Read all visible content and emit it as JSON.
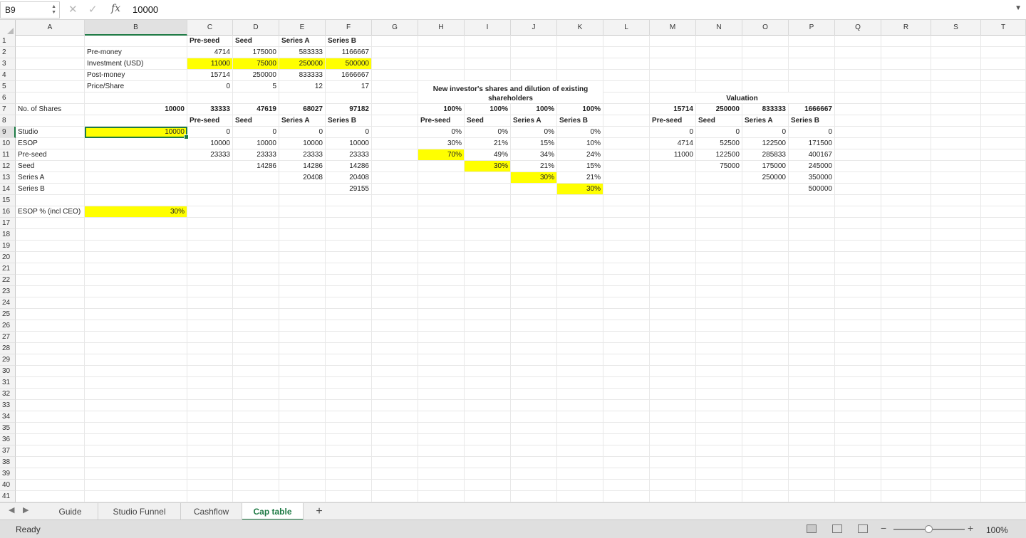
{
  "formula_bar": {
    "name_box": "B9",
    "fx_label": "fx",
    "value": "10000"
  },
  "columns": [
    "A",
    "B",
    "C",
    "D",
    "E",
    "F",
    "G",
    "H",
    "I",
    "J",
    "K",
    "L",
    "M",
    "N",
    "O",
    "P",
    "Q",
    "R",
    "S",
    "T"
  ],
  "selected_column": "B",
  "selected_row": 9,
  "row_count": 41,
  "cells": [
    {
      "r": 1,
      "c": "C",
      "v": "Pre-seed",
      "t": "txt",
      "b": true
    },
    {
      "r": 1,
      "c": "D",
      "v": "Seed",
      "t": "txt",
      "b": true
    },
    {
      "r": 1,
      "c": "E",
      "v": "Series A",
      "t": "txt",
      "b": true
    },
    {
      "r": 1,
      "c": "F",
      "v": "Series B",
      "t": "txt",
      "b": true
    },
    {
      "r": 2,
      "c": "B",
      "v": "Pre-money",
      "t": "txt"
    },
    {
      "r": 2,
      "c": "C",
      "v": "4714",
      "t": "num"
    },
    {
      "r": 2,
      "c": "D",
      "v": "175000",
      "t": "num"
    },
    {
      "r": 2,
      "c": "E",
      "v": "583333",
      "t": "num"
    },
    {
      "r": 2,
      "c": "F",
      "v": "1166667",
      "t": "num"
    },
    {
      "r": 3,
      "c": "B",
      "v": "Investment (USD)",
      "t": "txt"
    },
    {
      "r": 3,
      "c": "C",
      "v": "11000",
      "t": "num",
      "y": true
    },
    {
      "r": 3,
      "c": "D",
      "v": "75000",
      "t": "num",
      "y": true
    },
    {
      "r": 3,
      "c": "E",
      "v": "250000",
      "t": "num",
      "y": true
    },
    {
      "r": 3,
      "c": "F",
      "v": "500000",
      "t": "num",
      "y": true
    },
    {
      "r": 4,
      "c": "B",
      "v": "Post-money",
      "t": "txt"
    },
    {
      "r": 4,
      "c": "C",
      "v": "15714",
      "t": "num"
    },
    {
      "r": 4,
      "c": "D",
      "v": "250000",
      "t": "num"
    },
    {
      "r": 4,
      "c": "E",
      "v": "833333",
      "t": "num"
    },
    {
      "r": 4,
      "c": "F",
      "v": "1666667",
      "t": "num"
    },
    {
      "r": 5,
      "c": "B",
      "v": "Price/Share",
      "t": "txt"
    },
    {
      "r": 5,
      "c": "C",
      "v": "0",
      "t": "num"
    },
    {
      "r": 5,
      "c": "D",
      "v": "5",
      "t": "num"
    },
    {
      "r": 5,
      "c": "E",
      "v": "12",
      "t": "num"
    },
    {
      "r": 5,
      "c": "F",
      "v": "17",
      "t": "num"
    },
    {
      "r": 7,
      "c": "A",
      "v": "No. of Shares",
      "t": "txt"
    },
    {
      "r": 7,
      "c": "B",
      "v": "10000",
      "t": "num",
      "b": true
    },
    {
      "r": 7,
      "c": "C",
      "v": "33333",
      "t": "num",
      "b": true
    },
    {
      "r": 7,
      "c": "D",
      "v": "47619",
      "t": "num",
      "b": true
    },
    {
      "r": 7,
      "c": "E",
      "v": "68027",
      "t": "num",
      "b": true
    },
    {
      "r": 7,
      "c": "F",
      "v": "97182",
      "t": "num",
      "b": true
    },
    {
      "r": 7,
      "c": "H",
      "v": "100%",
      "t": "num",
      "b": true
    },
    {
      "r": 7,
      "c": "I",
      "v": "100%",
      "t": "num",
      "b": true
    },
    {
      "r": 7,
      "c": "J",
      "v": "100%",
      "t": "num",
      "b": true
    },
    {
      "r": 7,
      "c": "K",
      "v": "100%",
      "t": "num",
      "b": true
    },
    {
      "r": 7,
      "c": "M",
      "v": "15714",
      "t": "num",
      "b": true
    },
    {
      "r": 7,
      "c": "N",
      "v": "250000",
      "t": "num",
      "b": true
    },
    {
      "r": 7,
      "c": "O",
      "v": "833333",
      "t": "num",
      "b": true
    },
    {
      "r": 7,
      "c": "P",
      "v": "1666667",
      "t": "num",
      "b": true
    },
    {
      "r": 8,
      "c": "C",
      "v": "Pre-seed",
      "t": "txt",
      "b": true
    },
    {
      "r": 8,
      "c": "D",
      "v": "Seed",
      "t": "txt",
      "b": true
    },
    {
      "r": 8,
      "c": "E",
      "v": "Series A",
      "t": "txt",
      "b": true
    },
    {
      "r": 8,
      "c": "F",
      "v": "Series B",
      "t": "txt",
      "b": true
    },
    {
      "r": 8,
      "c": "H",
      "v": "Pre-seed",
      "t": "txt",
      "b": true
    },
    {
      "r": 8,
      "c": "I",
      "v": "Seed",
      "t": "txt",
      "b": true
    },
    {
      "r": 8,
      "c": "J",
      "v": "Series A",
      "t": "txt",
      "b": true
    },
    {
      "r": 8,
      "c": "K",
      "v": "Series B",
      "t": "txt",
      "b": true
    },
    {
      "r": 8,
      "c": "M",
      "v": "Pre-seed",
      "t": "txt",
      "b": true
    },
    {
      "r": 8,
      "c": "N",
      "v": "Seed",
      "t": "txt",
      "b": true
    },
    {
      "r": 8,
      "c": "O",
      "v": "Series A",
      "t": "txt",
      "b": true
    },
    {
      "r": 8,
      "c": "P",
      "v": "Series B",
      "t": "txt",
      "b": true
    },
    {
      "r": 9,
      "c": "A",
      "v": "Studio",
      "t": "txt"
    },
    {
      "r": 9,
      "c": "B",
      "v": "10000",
      "t": "num",
      "y": true,
      "active": true
    },
    {
      "r": 9,
      "c": "C",
      "v": "0",
      "t": "num"
    },
    {
      "r": 9,
      "c": "D",
      "v": "0",
      "t": "num"
    },
    {
      "r": 9,
      "c": "E",
      "v": "0",
      "t": "num"
    },
    {
      "r": 9,
      "c": "F",
      "v": "0",
      "t": "num"
    },
    {
      "r": 9,
      "c": "H",
      "v": "0%",
      "t": "num"
    },
    {
      "r": 9,
      "c": "I",
      "v": "0%",
      "t": "num"
    },
    {
      "r": 9,
      "c": "J",
      "v": "0%",
      "t": "num"
    },
    {
      "r": 9,
      "c": "K",
      "v": "0%",
      "t": "num"
    },
    {
      "r": 9,
      "c": "M",
      "v": "0",
      "t": "num"
    },
    {
      "r": 9,
      "c": "N",
      "v": "0",
      "t": "num"
    },
    {
      "r": 9,
      "c": "O",
      "v": "0",
      "t": "num"
    },
    {
      "r": 9,
      "c": "P",
      "v": "0",
      "t": "num"
    },
    {
      "r": 10,
      "c": "A",
      "v": "ESOP",
      "t": "txt"
    },
    {
      "r": 10,
      "c": "C",
      "v": "10000",
      "t": "num"
    },
    {
      "r": 10,
      "c": "D",
      "v": "10000",
      "t": "num"
    },
    {
      "r": 10,
      "c": "E",
      "v": "10000",
      "t": "num"
    },
    {
      "r": 10,
      "c": "F",
      "v": "10000",
      "t": "num"
    },
    {
      "r": 10,
      "c": "H",
      "v": "30%",
      "t": "num"
    },
    {
      "r": 10,
      "c": "I",
      "v": "21%",
      "t": "num"
    },
    {
      "r": 10,
      "c": "J",
      "v": "15%",
      "t": "num"
    },
    {
      "r": 10,
      "c": "K",
      "v": "10%",
      "t": "num"
    },
    {
      "r": 10,
      "c": "M",
      "v": "4714",
      "t": "num"
    },
    {
      "r": 10,
      "c": "N",
      "v": "52500",
      "t": "num"
    },
    {
      "r": 10,
      "c": "O",
      "v": "122500",
      "t": "num"
    },
    {
      "r": 10,
      "c": "P",
      "v": "171500",
      "t": "num"
    },
    {
      "r": 11,
      "c": "A",
      "v": "Pre-seed",
      "t": "txt"
    },
    {
      "r": 11,
      "c": "C",
      "v": "23333",
      "t": "num"
    },
    {
      "r": 11,
      "c": "D",
      "v": "23333",
      "t": "num"
    },
    {
      "r": 11,
      "c": "E",
      "v": "23333",
      "t": "num"
    },
    {
      "r": 11,
      "c": "F",
      "v": "23333",
      "t": "num"
    },
    {
      "r": 11,
      "c": "H",
      "v": "70%",
      "t": "num",
      "y": true
    },
    {
      "r": 11,
      "c": "I",
      "v": "49%",
      "t": "num"
    },
    {
      "r": 11,
      "c": "J",
      "v": "34%",
      "t": "num"
    },
    {
      "r": 11,
      "c": "K",
      "v": "24%",
      "t": "num"
    },
    {
      "r": 11,
      "c": "M",
      "v": "11000",
      "t": "num"
    },
    {
      "r": 11,
      "c": "N",
      "v": "122500",
      "t": "num"
    },
    {
      "r": 11,
      "c": "O",
      "v": "285833",
      "t": "num"
    },
    {
      "r": 11,
      "c": "P",
      "v": "400167",
      "t": "num"
    },
    {
      "r": 12,
      "c": "A",
      "v": "Seed",
      "t": "txt"
    },
    {
      "r": 12,
      "c": "D",
      "v": "14286",
      "t": "num"
    },
    {
      "r": 12,
      "c": "E",
      "v": "14286",
      "t": "num"
    },
    {
      "r": 12,
      "c": "F",
      "v": "14286",
      "t": "num"
    },
    {
      "r": 12,
      "c": "I",
      "v": "30%",
      "t": "num",
      "y": true
    },
    {
      "r": 12,
      "c": "J",
      "v": "21%",
      "t": "num"
    },
    {
      "r": 12,
      "c": "K",
      "v": "15%",
      "t": "num"
    },
    {
      "r": 12,
      "c": "N",
      "v": "75000",
      "t": "num"
    },
    {
      "r": 12,
      "c": "O",
      "v": "175000",
      "t": "num"
    },
    {
      "r": 12,
      "c": "P",
      "v": "245000",
      "t": "num"
    },
    {
      "r": 13,
      "c": "A",
      "v": "Series A",
      "t": "txt"
    },
    {
      "r": 13,
      "c": "E",
      "v": "20408",
      "t": "num"
    },
    {
      "r": 13,
      "c": "F",
      "v": "20408",
      "t": "num"
    },
    {
      "r": 13,
      "c": "J",
      "v": "30%",
      "t": "num",
      "y": true
    },
    {
      "r": 13,
      "c": "K",
      "v": "21%",
      "t": "num"
    },
    {
      "r": 13,
      "c": "O",
      "v": "250000",
      "t": "num"
    },
    {
      "r": 13,
      "c": "P",
      "v": "350000",
      "t": "num"
    },
    {
      "r": 14,
      "c": "A",
      "v": "Series B",
      "t": "txt"
    },
    {
      "r": 14,
      "c": "F",
      "v": "29155",
      "t": "num"
    },
    {
      "r": 14,
      "c": "K",
      "v": "30%",
      "t": "num",
      "y": true
    },
    {
      "r": 14,
      "c": "P",
      "v": "500000",
      "t": "num"
    },
    {
      "r": 16,
      "c": "A",
      "v": "ESOP % (incl CEO)",
      "t": "txt"
    },
    {
      "r": 16,
      "c": "B",
      "v": "30%",
      "t": "num",
      "y": true
    }
  ],
  "merged_labels": {
    "dilution_title": "New investor's shares and dilution of existing shareholders",
    "valuation_title": "Valuation"
  },
  "sheet_tabs": [
    "Guide",
    "Studio Funnel",
    "Cashflow",
    "Cap table"
  ],
  "active_tab": "Cap table",
  "status": {
    "text": "Ready",
    "zoom": "100%"
  },
  "colors": {
    "highlight": "#ffff00",
    "accent": "#1d7a44"
  }
}
